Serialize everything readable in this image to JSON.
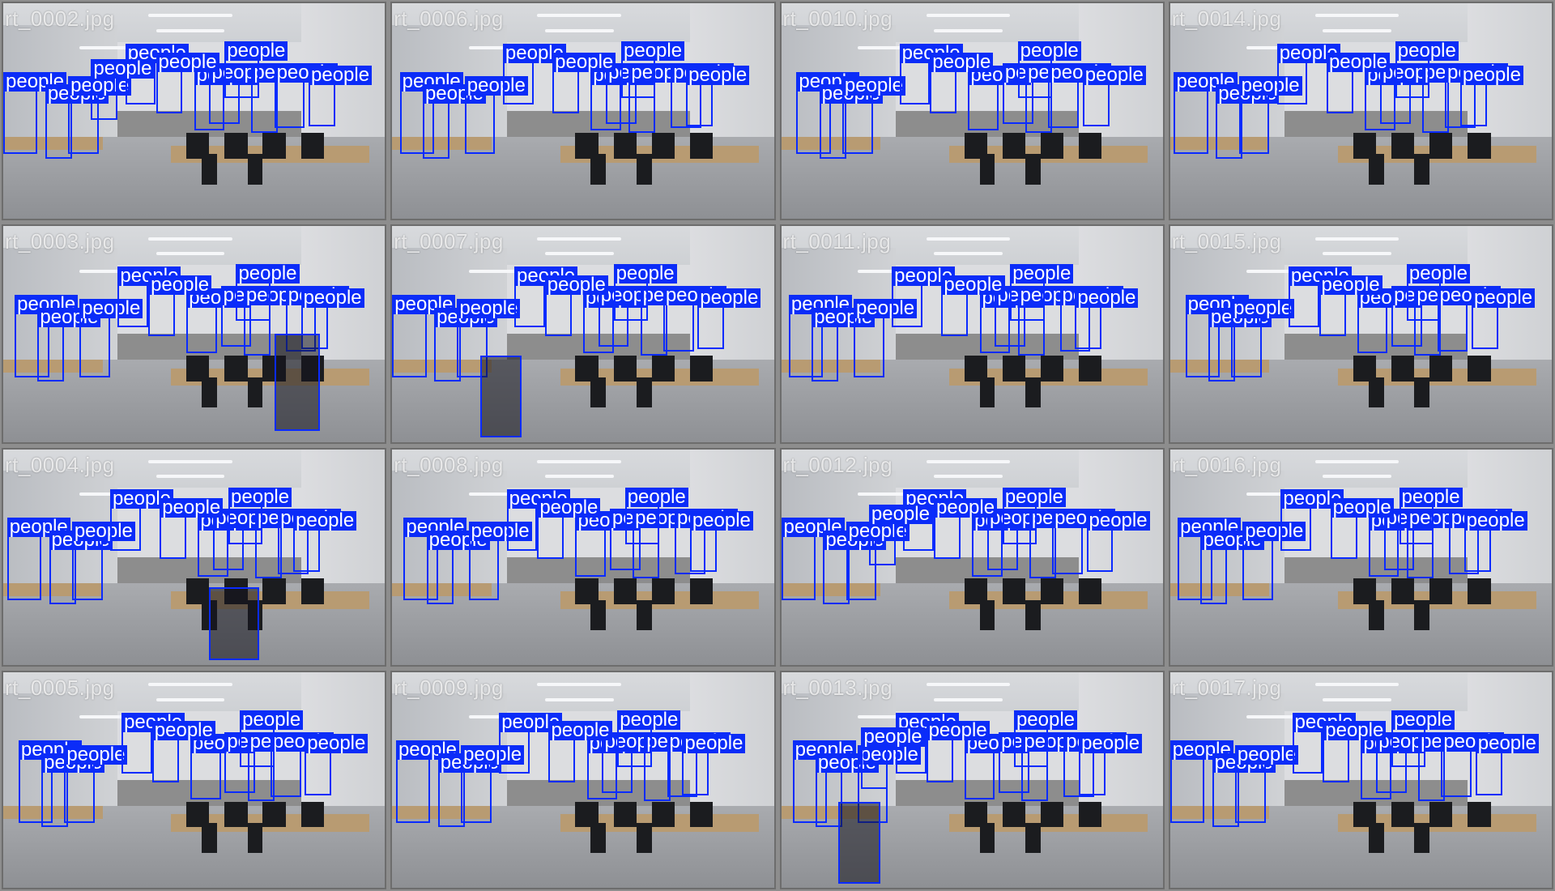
{
  "label_text": "people",
  "box_color": "#0a2bff",
  "tiles": [
    {
      "filename": "rt_0002.jpg",
      "person_count": 12
    },
    {
      "filename": "rt_0006.jpg",
      "person_count": 11
    },
    {
      "filename": "rt_0010.jpg",
      "person_count": 11
    },
    {
      "filename": "rt_0014.jpg",
      "person_count": 11
    },
    {
      "filename": "rt_0003.jpg",
      "person_count": 11
    },
    {
      "filename": "rt_0007.jpg",
      "person_count": 11
    },
    {
      "filename": "rt_0011.jpg",
      "person_count": 11
    },
    {
      "filename": "rt_0015.jpg",
      "person_count": 11
    },
    {
      "filename": "rt_0004.jpg",
      "person_count": 11
    },
    {
      "filename": "rt_0008.jpg",
      "person_count": 11
    },
    {
      "filename": "rt_0012.jpg",
      "person_count": 12
    },
    {
      "filename": "rt_0016.jpg",
      "person_count": 11
    },
    {
      "filename": "rt_0005.jpg",
      "person_count": 11
    },
    {
      "filename": "rt_0009.jpg",
      "person_count": 11
    },
    {
      "filename": "rt_0013.jpg",
      "person_count": 12
    },
    {
      "filename": "rt_0017.jpg",
      "person_count": 11
    }
  ]
}
